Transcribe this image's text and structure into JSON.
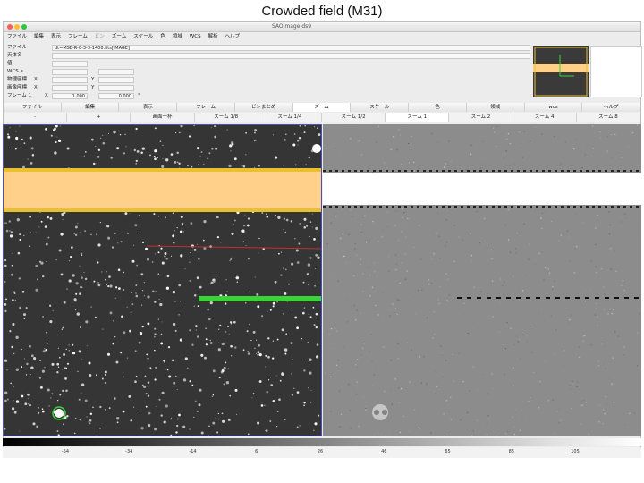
{
  "slide": {
    "title": "Crowded field (M31)"
  },
  "window": {
    "title": "SAOImage ds9"
  },
  "menu": [
    {
      "label": "ファイル",
      "enabled": true
    },
    {
      "label": "編集",
      "enabled": true
    },
    {
      "label": "表示",
      "enabled": true
    },
    {
      "label": "フレーム",
      "enabled": true
    },
    {
      "label": "ビン",
      "enabled": false
    },
    {
      "label": "ズーム",
      "enabled": true
    },
    {
      "label": "スケール",
      "enabled": true
    },
    {
      "label": "色",
      "enabled": true
    },
    {
      "label": "領域",
      "enabled": true
    },
    {
      "label": "WCS",
      "enabled": true
    },
    {
      "label": "解析",
      "enabled": true
    },
    {
      "label": "ヘルプ",
      "enabled": true
    }
  ],
  "info": {
    "file_label": "ファイル",
    "file_value": "dt=MSE-R-0-3-3-1400.fits[IMAGE]",
    "object_label": "天体名",
    "value_label": "値",
    "wcs_label": "WCS",
    "wcs_suffix": "a",
    "physical_label": "物理座標",
    "image_label": "画像座標",
    "frame_label": "フレーム 1",
    "x_label": "X",
    "y_label": "Y",
    "zoom_value": "1.000",
    "angle_value": "0.000",
    "degree": "°"
  },
  "buttons_main": [
    "ファイル",
    "編集",
    "表示",
    "フレーム",
    "ビンまとめ",
    "ズーム",
    "スケール",
    "色",
    "領域",
    "wcs",
    "ヘルプ"
  ],
  "buttons_main_active": 5,
  "buttons_zoom": [
    "-",
    "+",
    "画面一杯",
    "ズーム 1/8",
    "ズーム 1/4",
    "ズーム 1/2",
    "ズーム 1",
    "ズーム 2",
    "ズーム 4",
    "ズーム 8"
  ],
  "buttons_zoom_active": 6,
  "colorbar_ticks": [
    "-54",
    "-34",
    "-14",
    "6",
    "26",
    "46",
    "65",
    "85",
    "105"
  ],
  "colors": {
    "saturation_band": "#ffd08a",
    "band_edge": "#e8c030",
    "green_track": "#39d439",
    "red_line": "#c03030",
    "frame_highlight": "#4c4cc8"
  }
}
